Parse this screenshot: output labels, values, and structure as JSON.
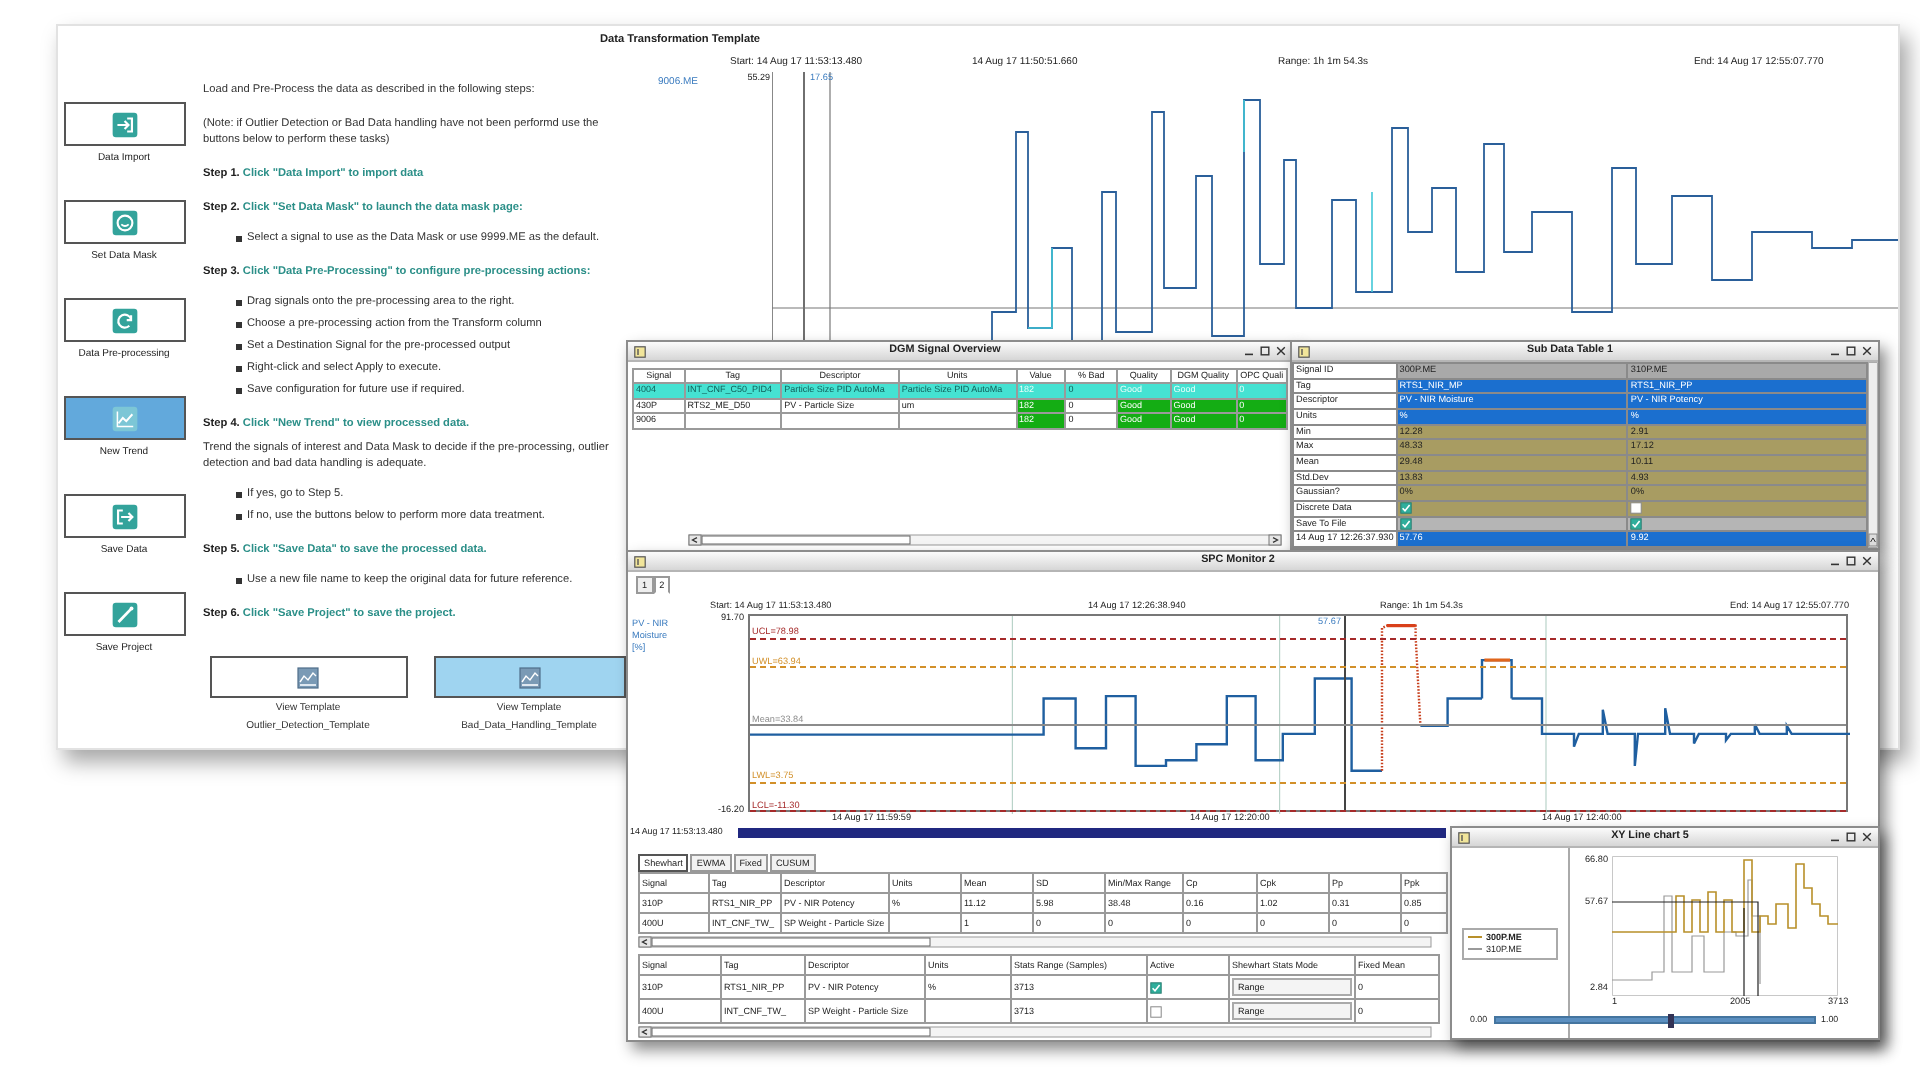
{
  "template": {
    "title": "Data Transformation Template",
    "side_buttons": [
      {
        "label": "Data Import",
        "kind": "import",
        "selected": false
      },
      {
        "label": "Set Data Mask",
        "kind": "mask",
        "selected": false
      },
      {
        "label": "Data Pre-processing",
        "kind": "process",
        "selected": false
      },
      {
        "label": "New Trend",
        "kind": "trend",
        "selected": true
      },
      {
        "label": "Save Data",
        "kind": "save",
        "selected": false
      },
      {
        "label": "Save Project",
        "kind": "project",
        "selected": false
      }
    ],
    "intro": "Load and Pre-Process the data as described in the following steps:",
    "note": "(Note: if Outlier Detection or Bad Data handling have not been performd use the buttons below to perform these tasks)",
    "steps": [
      {
        "label": "Step 1.",
        "action": "Click \"Data Import\" to import data"
      },
      {
        "label": "Step 2.",
        "action": "Click \"Set Data Mask\" to launch the data mask page:",
        "bullets": [
          "Select a signal to use as the Data Mask or use 9999.ME as the default."
        ]
      },
      {
        "label": "Step 3.",
        "action": "Click \"Data Pre-Processing\" to configure pre-processing actions:",
        "bullets": [
          "Drag signals onto the pre-processing area to the right.",
          "Choose a pre-processing action from the Transform column",
          "Set a Destination Signal for the pre-processed output",
          "Right-click and select Apply to execute.",
          "Save configuration for future use if required."
        ]
      },
      {
        "label": "Step 4.",
        "action": "Click \"New Trend\" to view processed data.",
        "text": "Trend the signals of interest and Data Mask to decide if the pre-processing, outlier detection and bad data handling is adequate.",
        "bullets": [
          "If yes, go to Step 5.",
          "If no, use the buttons below to perform more data treatment."
        ]
      },
      {
        "label": "Step 5.",
        "action": "Click \"Save Data\" to save the processed data.",
        "bullets": [
          "Use a new file name to keep the original data for future reference."
        ]
      },
      {
        "label": "Step 6.",
        "action": "Click \"Save Project\" to save the project."
      }
    ],
    "template_buttons": [
      {
        "label": "View Template",
        "template": "Outlier_Detection_Template",
        "selected": false
      },
      {
        "label": "View Template",
        "template": "Bad_Data_Handling_Template",
        "selected": true
      }
    ],
    "trend": {
      "start": "Start: 14 Aug 17 11:53:13.480",
      "cursor": "14 Aug 17 11:50:51.660",
      "range": "Range: 1h 1m 54.3s",
      "end": "End: 14 Aug 17 12:55:07.770",
      "signal": "9006.ME",
      "y_max": "55.29",
      "cursor_value": "17.65"
    }
  },
  "dgm": {
    "title": "DGM Signal Overview",
    "columns": [
      {
        "label": "Signal",
        "kind": "text"
      },
      {
        "label": "Tag",
        "kind": "text"
      },
      {
        "label": "Descriptor",
        "kind": "text"
      },
      {
        "label": "Units",
        "kind": "text"
      },
      {
        "label": "Value",
        "kind": "status"
      },
      {
        "label": "% Bad",
        "kind": "text"
      },
      {
        "label": "Quality",
        "kind": "status"
      },
      {
        "label": "DGM Quality",
        "kind": "status"
      },
      {
        "label": "OPC Quali",
        "kind": "status"
      }
    ],
    "rows": [
      {
        "cells": [
          "4004",
          "INT_CNF_C50_PID4",
          "Particle Size PID AutoMa",
          "Particle Size PID AutoMa",
          "182",
          "0",
          "Good",
          "Good",
          "0"
        ],
        "selected": true
      },
      {
        "cells": [
          "430P",
          "RTS2_ME_D50",
          "PV - Particle Size",
          "um",
          "182",
          "0",
          "Good",
          "Good",
          "0"
        ],
        "selected": false
      },
      {
        "cells": [
          "9006",
          null,
          null,
          null,
          "182",
          "0",
          "Good",
          "Good",
          "0"
        ],
        "selected": false
      }
    ]
  },
  "sub_table": {
    "title": "Sub Data Table 1",
    "rows": [
      {
        "label": "Signal ID",
        "kind": "header",
        "values": [
          "300P.ME",
          "310P.ME"
        ]
      },
      {
        "label": "Tag",
        "kind": "info",
        "values": [
          "RTS1_NIR_MP",
          "RTS1_NIR_PP"
        ]
      },
      {
        "label": "Descriptor",
        "kind": "info",
        "values": [
          "PV - NIR Moisture",
          "PV - NIR Potency"
        ]
      },
      {
        "label": "Units",
        "kind": "info",
        "values": [
          "%",
          "%"
        ]
      },
      {
        "label": "Min",
        "kind": "stat",
        "values": [
          "12.28",
          "2.91"
        ]
      },
      {
        "label": "Max",
        "kind": "stat",
        "values": [
          "48.33",
          "17.12"
        ]
      },
      {
        "label": "Mean",
        "kind": "stat",
        "values": [
          "29.48",
          "10.11"
        ]
      },
      {
        "label": "Std.Dev",
        "kind": "stat",
        "values": [
          "13.83",
          "4.93"
        ]
      },
      {
        "label": "Gaussian?",
        "kind": "stat",
        "values": [
          "0%",
          "0%"
        ]
      },
      {
        "label": "Discrete Data",
        "kind": "flag",
        "checked": [
          true,
          false
        ]
      },
      {
        "label": "Save To File",
        "kind": "option",
        "checked": [
          true,
          true
        ]
      },
      {
        "label": "14 Aug 17 12:26:37.930",
        "kind": "live",
        "values": [
          "57.76",
          "9.92"
        ]
      }
    ]
  },
  "spc": {
    "title": "SPC Monitor 2",
    "tabs": [
      {
        "label": "1",
        "selected": false
      },
      {
        "label": "2",
        "selected": true
      }
    ],
    "chart": {
      "start": "Start: 14 Aug 17 11:53:13.480",
      "cursor": "14 Aug 17 12:26:38.940",
      "range": "Range: 1h 1m 54.3s",
      "end": "End: 14 Aug 17 12:55:07.770",
      "signal": "PV - NIR Moisture",
      "units": "[%]",
      "y_max": "91.70",
      "y_min": "-16.20",
      "cursor_value": "57.67",
      "limits": [
        {
          "label": "UCL=78.98",
          "color": "#a52a2a"
        },
        {
          "label": "UWL=63.94",
          "color": "#d2902a"
        },
        {
          "label": "Mean=33.84",
          "color": "#8c8c8c"
        },
        {
          "label": "LWL=3.75",
          "color": "#d2902a"
        },
        {
          "label": "LCL=-11.30",
          "color": "#a52a2a"
        }
      ],
      "x_labels": [
        "14 Aug 17 11:59:59",
        "14 Aug 17 12:20:00",
        "14 Aug 17 12:40:00"
      ],
      "position": "14 Aug 17 11:53:13.480"
    },
    "stats_tabs": [
      {
        "label": "Shewhart",
        "selected": true
      },
      {
        "label": "EWMA",
        "selected": false
      },
      {
        "label": "Fixed",
        "selected": false
      },
      {
        "label": "CUSUM",
        "selected": false
      }
    ],
    "stats_table": {
      "columns": [
        "Signal",
        "Tag",
        "Descriptor",
        "Units",
        "Mean",
        "SD",
        "Min/Max Range",
        "Cp",
        "Cpk",
        "Pp",
        "Ppk"
      ],
      "rows": [
        [
          "310P",
          "RTS1_NIR_PP",
          "PV - NIR Potency",
          "%",
          "11.12",
          "5.98",
          "38.48",
          "0.16",
          "1.02",
          "0.31",
          "0.85"
        ],
        [
          "400U",
          "INT_CNF_TW_",
          "SP Weight - Particle Size",
          null,
          "1",
          "0",
          "0",
          "0",
          "0",
          "0",
          "0"
        ]
      ]
    },
    "config_table": {
      "columns": [
        "Signal",
        "Tag",
        "Descriptor",
        "Units",
        "Stats Range (Samples)",
        "Active",
        "Shewhart Stats Mode",
        "Fixed Mean"
      ],
      "rows": [
        {
          "signal": "310P",
          "tag": "RTS1_NIR_PP",
          "descriptor": "PV - NIR Potency",
          "units": "%",
          "range": "3713",
          "active": true,
          "mode": "Range",
          "fixed_mean": "0"
        },
        {
          "signal": "400U",
          "tag": "INT_CNF_TW_",
          "descriptor": "SP Weight - Particle Size",
          "range": "3713",
          "active": false,
          "mode": "Range",
          "fixed_mean": "0"
        }
      ]
    }
  },
  "xy": {
    "title": "XY Line chart 5",
    "legend": [
      {
        "label": "300P.ME",
        "color": "#b8902a",
        "selected": true
      },
      {
        "label": "310P.ME",
        "color": "#9a9a9a",
        "selected": false
      }
    ],
    "y_labels": [
      "66.80",
      "57.67",
      "2.84"
    ],
    "x_labels": [
      "1",
      "2005",
      "3713"
    ],
    "slider": {
      "min": "0.00",
      "max": "1.00",
      "level": 0.55
    }
  }
}
